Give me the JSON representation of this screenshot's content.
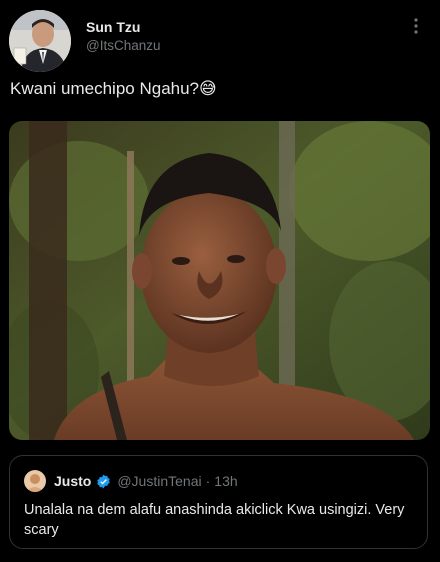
{
  "tweet": {
    "display_name": "Sun Tzu",
    "handle": "@ItsChanzu",
    "text": "Kwani umechipo Ngahu?😅",
    "more_icon": "more-options-icon"
  },
  "quote": {
    "display_name": "Justo",
    "handle": "@JustinTenai",
    "separator": "·",
    "time": "13h",
    "text": "Unalala na dem alafu anashinda akiclick Kwa usingizi. Very scary",
    "verified_color": "#1d9bf0"
  },
  "colors": {
    "background": "#000000",
    "text": "#e7e9ea",
    "secondary": "#71767b",
    "border": "#2f3336"
  }
}
